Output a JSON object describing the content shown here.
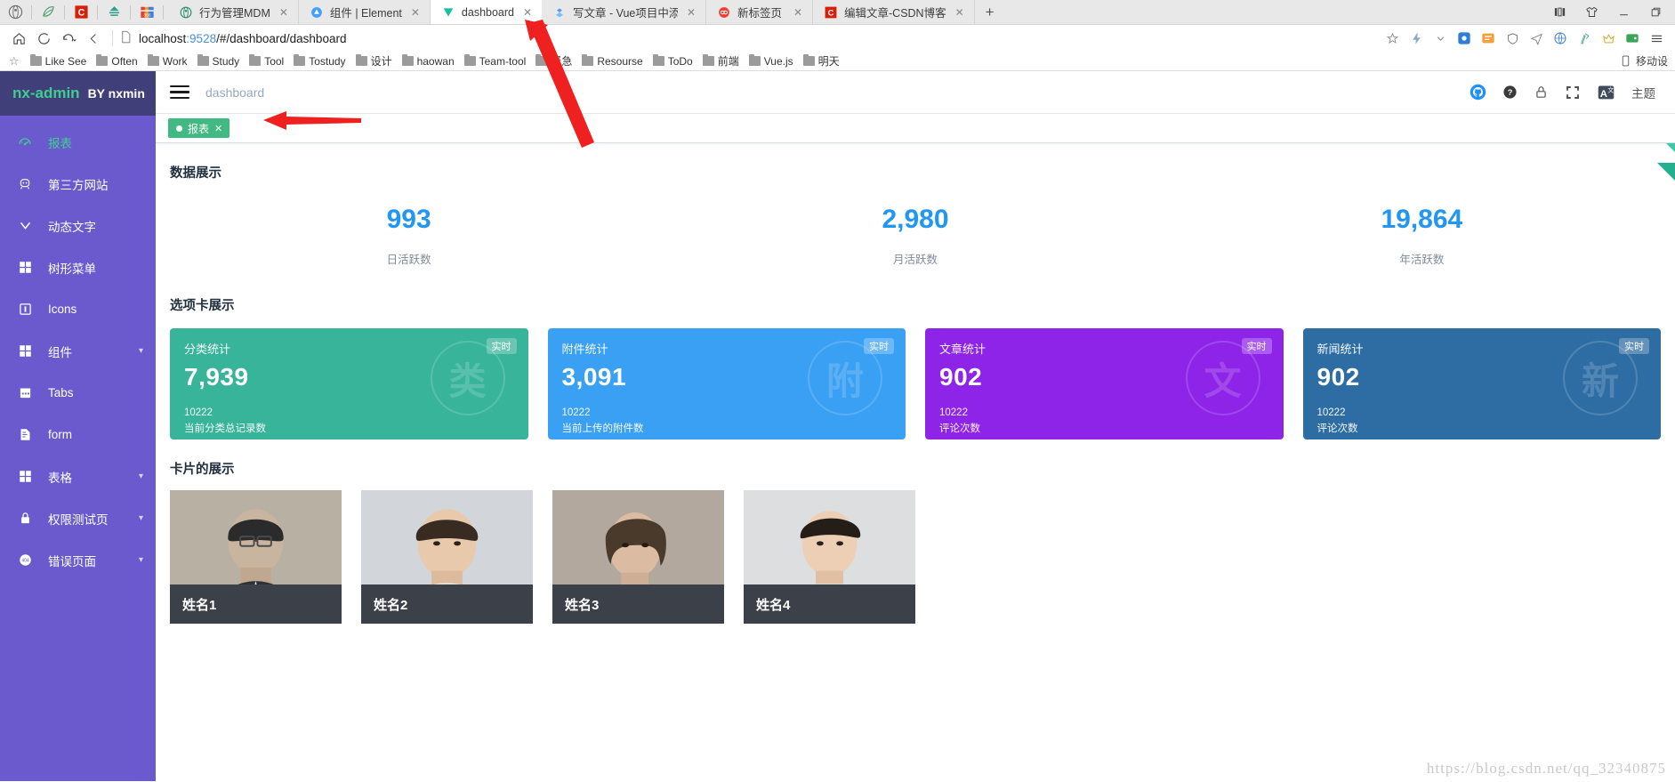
{
  "browser": {
    "quick_icons": [
      "tor-browser-icon",
      "leaf-icon",
      "csdn-icon",
      "cloud-icon",
      "calendar365-icon"
    ],
    "tabs": [
      {
        "title": "行为管理MDM",
        "favicon": "tor-icon",
        "active": false
      },
      {
        "title": "组件 | Element",
        "favicon": "element-icon",
        "active": false
      },
      {
        "title": "dashboard",
        "favicon": "vue-shield-icon",
        "active": true
      },
      {
        "title": "写文章 - Vue项目中添加锁屏",
        "favicon": "juejin-icon",
        "active": false
      },
      {
        "title": "新标签页",
        "favicon": "infinity-icon",
        "active": false
      },
      {
        "title": "编辑文章-CSDN博客",
        "favicon": "csdn-icon",
        "active": false
      }
    ],
    "new_tab_label": "+",
    "window_controls": [
      "split-view-icon",
      "shirt-icon",
      "minimize-icon",
      "restore-icon"
    ],
    "toolbar": {
      "home_label": "⌂",
      "reload_label": "↻",
      "history_label": "↶",
      "back_label": "‹",
      "url_prefix": "localhost",
      "url_port": ":9528",
      "url_path": "/#/dashboard/dashboard",
      "right_icons": [
        "star-icon",
        "lightning-icon",
        "chevron-down-icon",
        "extension-blue-icon",
        "notes-icon",
        "shield-icon",
        "send-icon",
        "translate-icon",
        "cleaner-icon",
        "vip-icon",
        "wallet-icon",
        "menu-icon"
      ]
    },
    "bookmarks": {
      "items": [
        "Like See",
        "Often",
        "Work",
        "Study",
        "Tool",
        "Tostudy",
        "设计",
        "haowan",
        "Team-tool",
        "紧急",
        "Resourse",
        "ToDo",
        "前端",
        "Vue.js",
        "明天"
      ],
      "right_label": "移动设"
    }
  },
  "sidebar": {
    "brand_main": "nx-admin",
    "brand_sub": "BY nxmin",
    "items": [
      {
        "label": "报表",
        "icon": "dashboard-icon",
        "active": true,
        "expandable": false
      },
      {
        "label": "第三方网站",
        "icon": "train-icon",
        "active": false,
        "expandable": false
      },
      {
        "label": "动态文字",
        "icon": "chevron-down-icon",
        "active": false,
        "expandable": false
      },
      {
        "label": "树形菜单",
        "icon": "grid-icon",
        "active": false,
        "expandable": false
      },
      {
        "label": "Icons",
        "icon": "info-square-icon",
        "active": false,
        "expandable": false
      },
      {
        "label": "组件",
        "icon": "grid-icon",
        "active": false,
        "expandable": true
      },
      {
        "label": "Tabs",
        "icon": "calendar-icon",
        "active": false,
        "expandable": false
      },
      {
        "label": "form",
        "icon": "form-icon",
        "active": false,
        "expandable": false
      },
      {
        "label": "表格",
        "icon": "grid-icon",
        "active": false,
        "expandable": true
      },
      {
        "label": "权限测试页",
        "icon": "lock-icon",
        "active": false,
        "expandable": true
      },
      {
        "label": "错误页面",
        "icon": "error-404-icon",
        "active": false,
        "expandable": true
      }
    ]
  },
  "navbar": {
    "breadcrumb": "dashboard",
    "icons": [
      "github-icon",
      "help-icon",
      "lock-icon",
      "fullscreen-icon",
      "language-icon"
    ],
    "theme_label": "主题"
  },
  "tags_view": {
    "tags": [
      {
        "label": "报表",
        "active": true,
        "closable": true
      }
    ]
  },
  "main": {
    "section_data_title": "数据展示",
    "section_cards_title": "选项卡展示",
    "section_people_title": "卡片的展示",
    "stats": [
      {
        "value": "993",
        "label": "日活跃数"
      },
      {
        "value": "2,980",
        "label": "月活跃数"
      },
      {
        "value": "19,864",
        "label": "年活跃数"
      }
    ],
    "stat_color": "#2196f3",
    "cards": [
      {
        "title": "分类统计",
        "value": "7,939",
        "sub1": "10222",
        "sub2": "当前分类总记录数",
        "badge": "实时",
        "color": "#38b49a",
        "ghost": "类"
      },
      {
        "title": "附件统计",
        "value": "3,091",
        "sub1": "10222",
        "sub2": "当前上传的附件数",
        "badge": "实时",
        "color": "#3aa0f3",
        "ghost": "附"
      },
      {
        "title": "文章统计",
        "value": "902",
        "sub1": "10222",
        "sub2": "评论次数",
        "badge": "实时",
        "color": "#8e24e8",
        "ghost": "文"
      },
      {
        "title": "新闻统计",
        "value": "902",
        "sub1": "10222",
        "sub2": "评论次数",
        "badge": "实时",
        "color": "#2e6da4",
        "ghost": "新"
      }
    ],
    "people": [
      {
        "name": "姓名1",
        "skin": "#c6b8a8",
        "hair": "#2b2b2b",
        "suit": "#2f3136",
        "bg": "#bfb6aa"
      },
      {
        "name": "姓名2",
        "skin": "#e4c4a8",
        "hair": "#3a2b22",
        "suit": "#e8e4df",
        "bg": "#cfd4d8"
      },
      {
        "name": "姓名3",
        "skin": "#d8b9a0",
        "hair": "#4a3a2c",
        "suit": "#1d1d1d",
        "bg": "#b6aca2"
      },
      {
        "name": "姓名4",
        "skin": "#e8cdb4",
        "hair": "#241d18",
        "suit": "#26272b",
        "bg": "#dadcde"
      }
    ],
    "watermark": "https://blog.csdn.net/qq_32340875"
  }
}
